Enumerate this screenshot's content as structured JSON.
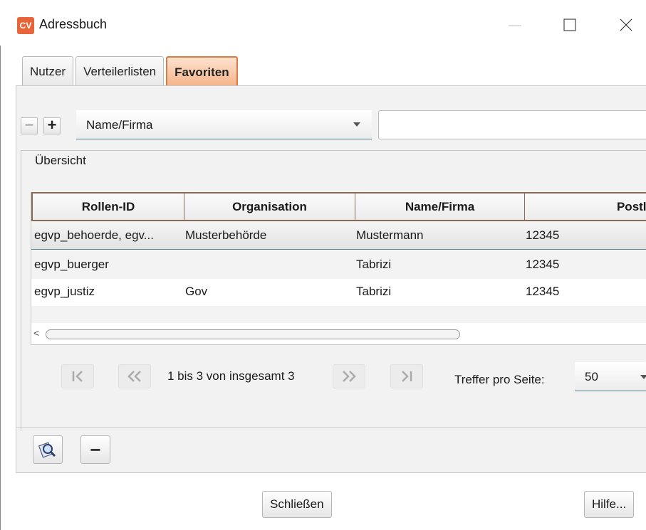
{
  "window": {
    "app_icon_text": "CV",
    "title": "Adressbuch"
  },
  "tabs": [
    {
      "label": "Nutzer",
      "active": false
    },
    {
      "label": "Verteilerlisten",
      "active": false
    },
    {
      "label": "Favoriten",
      "active": true
    }
  ],
  "filter": {
    "field_selected": "Name/Firma",
    "value": ""
  },
  "overview": {
    "label": "Übersicht",
    "columns": [
      "Rollen-ID",
      "Organisation",
      "Name/Firma",
      "Postle"
    ],
    "rows": [
      {
        "rollen_id": "egvp_behoerde, egv...",
        "organisation": "Musterbehörde",
        "name": "Mustermann",
        "plz": "12345",
        "selected": true
      },
      {
        "rollen_id": "egvp_buerger",
        "organisation": "",
        "name": "Tabrizi",
        "plz": "12345",
        "selected": false
      },
      {
        "rollen_id": "egvp_justiz",
        "organisation": "Gov",
        "name": "Tabrizi",
        "plz": "12345",
        "selected": false
      }
    ]
  },
  "pagination": {
    "first_label": "I<",
    "prev_label": "<<",
    "info": "1 bis 3 von insgesamt 3",
    "next_label": ">>",
    "last_label": ">I",
    "per_page_label": "Treffer pro Seite:",
    "per_page_value": "50"
  },
  "actions": {
    "details_icon": "magnifier-card-icon",
    "remove_label": "−"
  },
  "footer": {
    "close_label": "Schließen",
    "help_label": "Hilfe..."
  },
  "colors": {
    "active_tab_bg": "#f5b489",
    "active_tab_border": "#d77c43",
    "app_icon": "#e8653a",
    "accent_line": "#4f7f8a"
  }
}
